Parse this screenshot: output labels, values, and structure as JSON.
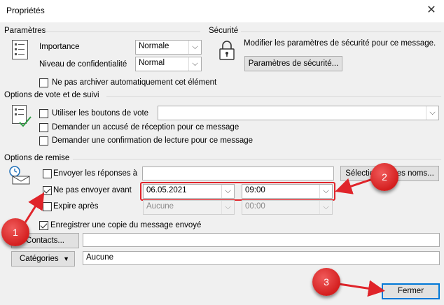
{
  "window": {
    "title": "Propriétés",
    "close_glyph": "✕"
  },
  "parametres": {
    "heading": "Paramètres",
    "importance_label": "Importance",
    "importance_value": "Normale",
    "confidentialite_label": "Niveau de confidentialité",
    "confidentialite_value": "Normal",
    "no_archive_label": "Ne pas archiver automatiquement cet élément"
  },
  "securite": {
    "heading": "Sécurité",
    "description": "Modifier les paramètres de sécurité pour ce message.",
    "button": "Paramètres de sécurité..."
  },
  "vote": {
    "heading": "Options de vote et de suivi",
    "use_buttons_label": "Utiliser les boutons de vote",
    "use_buttons_value": "",
    "read_receipt_label": "Demander un accusé de réception pour ce message",
    "read_confirm_label": "Demander une confirmation de lecture pour ce message"
  },
  "remise": {
    "heading": "Options de remise",
    "send_replies_label": "Envoyer les réponses à",
    "send_replies_value": "",
    "select_names_button": "Sélectionner des noms...",
    "not_before_label": "Ne pas envoyer avant",
    "not_before_date": "06.05.2021",
    "not_before_time": "09:00",
    "expires_label": "Expire après",
    "expires_date": "Aucune",
    "expires_time": "00:00",
    "save_copy_label": "Enregistrer une copie du message envoyé"
  },
  "contacts": {
    "button": "Contacts...",
    "value": ""
  },
  "categories": {
    "button": "Catégories",
    "value": "Aucune"
  },
  "footer": {
    "close_button": "Fermer"
  },
  "annotations": [
    "1",
    "2",
    "3"
  ],
  "colors": {
    "annotation": "#d41f1f",
    "focus": "#0078d7"
  }
}
